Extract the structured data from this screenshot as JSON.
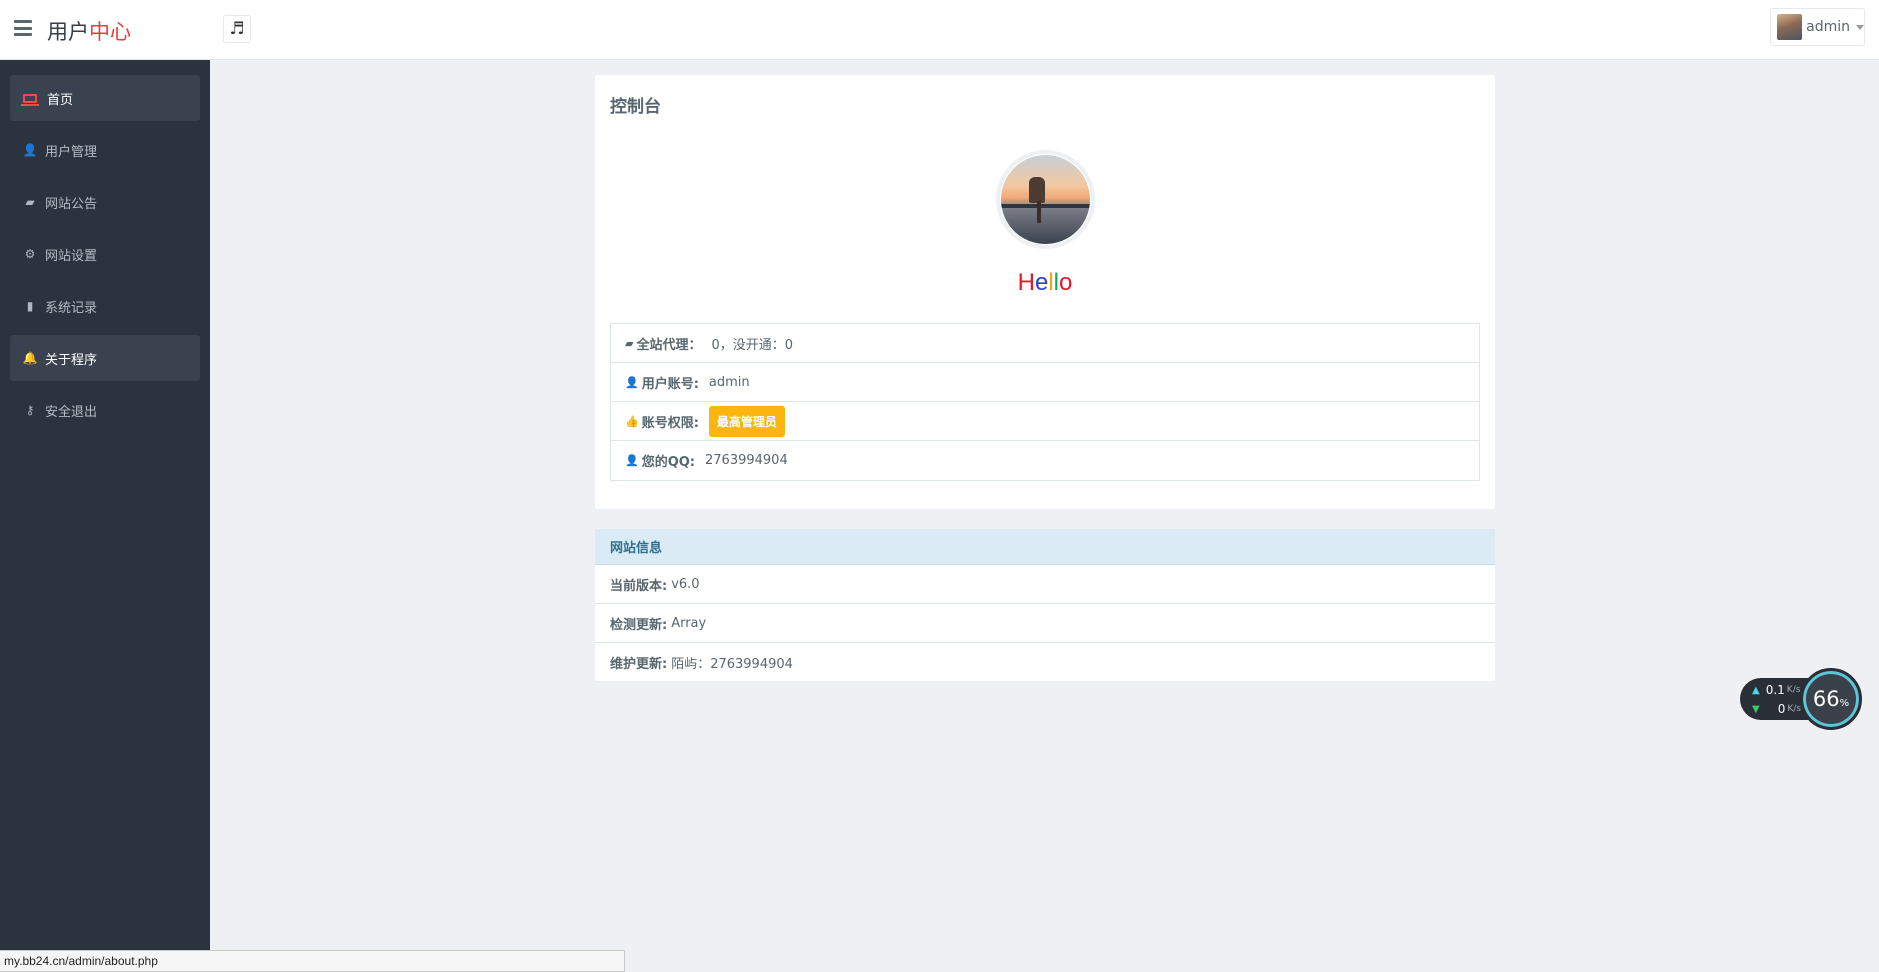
{
  "header": {
    "brand_part1": "用户",
    "brand_part2": "中心",
    "music_icon": "♬",
    "username": "admin"
  },
  "sidebar": {
    "items": [
      {
        "label": "首页",
        "icon": "laptop-icon",
        "glyph": ""
      },
      {
        "label": "用户管理",
        "icon": "user-icon",
        "glyph": "👤"
      },
      {
        "label": "网站公告",
        "icon": "book-icon",
        "glyph": "▰"
      },
      {
        "label": "网站设置",
        "icon": "gear-icon",
        "glyph": "⚙"
      },
      {
        "label": "系统记录",
        "icon": "bookmark-icon",
        "glyph": "▮"
      },
      {
        "label": "关于程序",
        "icon": "bell-icon",
        "glyph": "🔔"
      },
      {
        "label": "安全退出",
        "icon": "key-icon",
        "glyph": "⚷"
      }
    ]
  },
  "dashboard": {
    "title": "控制台",
    "hello": [
      "H",
      "e",
      "l",
      "l",
      "o"
    ],
    "rows": {
      "agents_label": "全站代理：",
      "agents_value": "0，没开通：0",
      "account_label": "用户账号:",
      "account_value": "admin",
      "role_label": "账号权限:",
      "role_value": "最高管理员",
      "qq_label": "您的QQ:",
      "qq_value": "2763994904"
    }
  },
  "site_info": {
    "title": "网站信息",
    "version_label": "当前版本:",
    "version_value": "v6.0",
    "update_label": "检测更新:",
    "update_value": "Array",
    "maintain_label": "维护更新:",
    "maintain_value": "陌屿：2763994904"
  },
  "net_widget": {
    "up": "0.1",
    "down": "0",
    "unit": "K/s",
    "percent": "66",
    "percent_sign": "%"
  },
  "status_bar": {
    "url": "my.bb24.cn/admin/about.php"
  },
  "colors": {
    "sidebar_bg": "#2b333e",
    "accent_red": "#f5494b",
    "badge": "#fab511",
    "panel_head": "#daebf5"
  }
}
